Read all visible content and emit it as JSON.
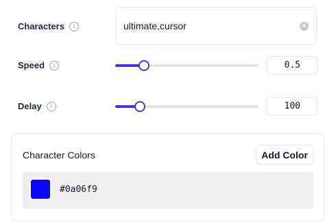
{
  "characters": {
    "label": "Characters",
    "value": "ultimate,cursor",
    "clear_icon": "x-circle-icon"
  },
  "speed": {
    "label": "Speed",
    "value": "0.5",
    "slider_fraction": 0.2
  },
  "delay": {
    "label": "Delay",
    "value": "100",
    "slider_fraction": 0.17
  },
  "info_icon": "i",
  "colors_panel": {
    "title": "Character Colors",
    "add_label": "Add Color",
    "colors": [
      {
        "hex": "#0a06f9"
      }
    ]
  },
  "accent": "#4f2de8"
}
